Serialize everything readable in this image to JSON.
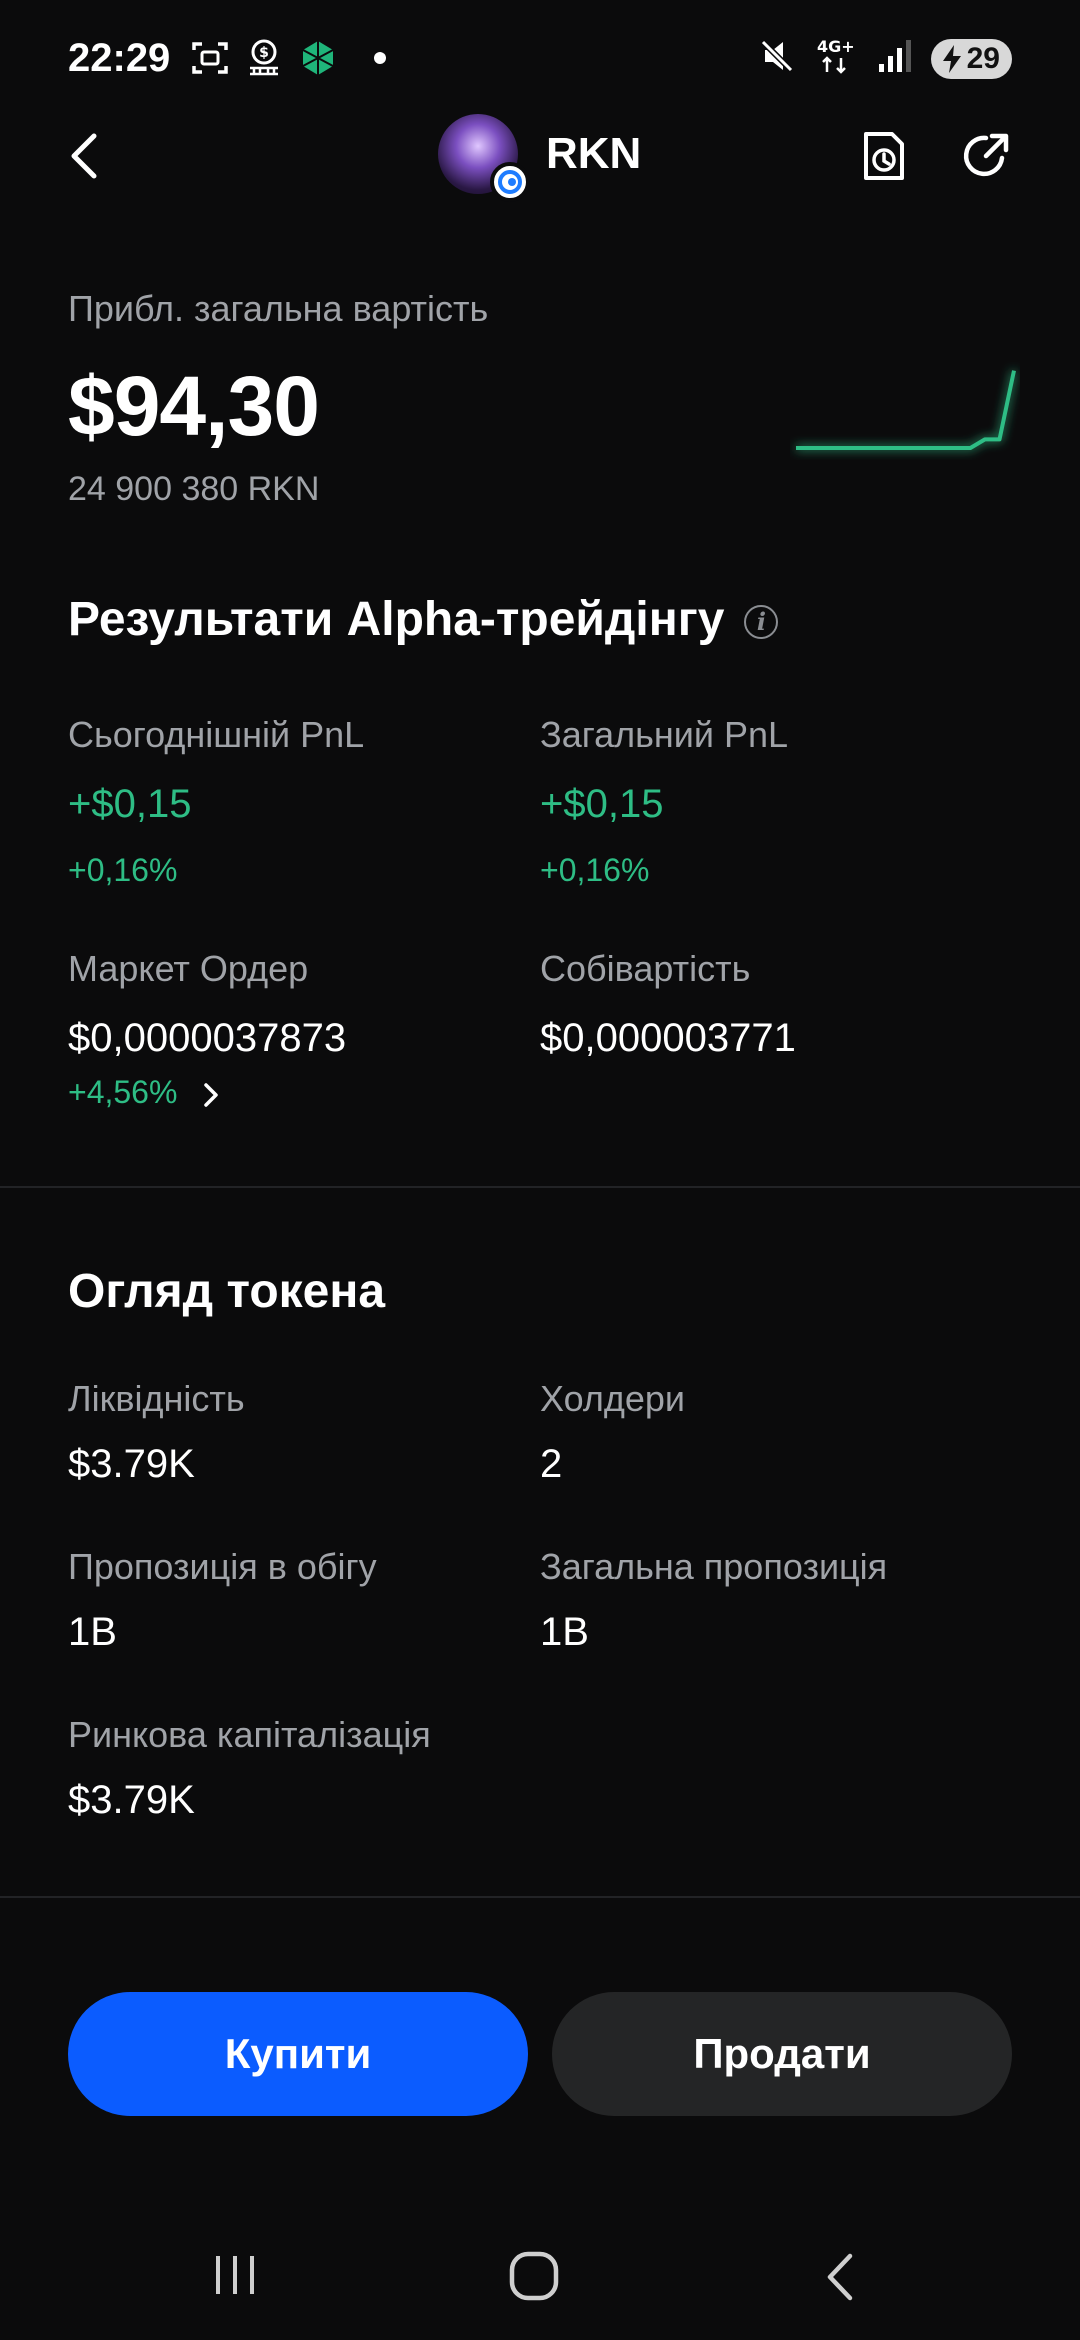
{
  "status_bar": {
    "time": "22:29",
    "network": "4G+",
    "battery": "29",
    "icons": [
      "screenshot-icon",
      "money-bag-icon",
      "crypto-app-icon",
      "dot-icon",
      "mute-icon",
      "network-4g-icon",
      "signal-icon",
      "battery-icon"
    ]
  },
  "header": {
    "title": "RKN",
    "icons": [
      "back-arrow-icon",
      "history-icon",
      "share-icon"
    ]
  },
  "value": {
    "label": "Прибл. загальна вартість",
    "amount": "$94,30",
    "quantity": "24 900 380 RKN",
    "sparkline": [
      0,
      0,
      0,
      0,
      0,
      0,
      0,
      0,
      0,
      0,
      0,
      0,
      0,
      0.1,
      0.1,
      0.9
    ]
  },
  "alpha": {
    "title": "Результати Alpha-трейдінгу",
    "today_pnl_label": "Сьогоднішній PnL",
    "today_pnl_value": "+$0,15",
    "today_pnl_pct": "+0,16%",
    "total_pnl_label": "Загальний PnL",
    "total_pnl_value": "+$0,15",
    "total_pnl_pct": "+0,16%",
    "market_label": "Маркет Ордер",
    "market_value": "$0,0000037873",
    "market_pct": "+4,56%",
    "cost_label": "Собівартість",
    "cost_value": "$0,000003771"
  },
  "overview": {
    "title": "Огляд токена",
    "liquidity_label": "Ліквідність",
    "liquidity_value": "$3.79K",
    "holders_label": "Холдери",
    "holders_value": "2",
    "circ_label": "Пропозиція в обігу",
    "circ_value": "1B",
    "total_supply_label": "Загальна пропозиція",
    "total_supply_value": "1B",
    "mcap_label": "Ринкова капіталізація",
    "mcap_value": "$3.79K"
  },
  "actions": {
    "buy": "Купити",
    "sell": "Продати"
  },
  "colors": {
    "background": "#0b0b0c",
    "green": "#2ebd85",
    "buy": "#0b5cff",
    "sell": "#242526",
    "muted": "#a0a3a8"
  }
}
